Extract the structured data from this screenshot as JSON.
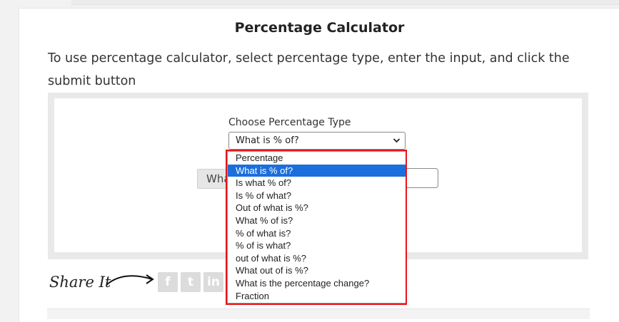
{
  "calculator": {
    "title": "Percentage Calculator",
    "instructions": "To use percentage calculator, select percentage type, enter the input, and click the submit button",
    "choose_label": "Choose Percentage Type",
    "selected_type": "What is % of?",
    "ghost_button_text": "Wha"
  },
  "dropdown": {
    "options": [
      "Percentage",
      "What is % of?",
      "Is what % of?",
      "Is % of what?",
      "Out of what is %?",
      "What % of is?",
      "% of what is?",
      "% of is what?",
      "out of what is %?",
      "What out of is %?",
      "What is the percentage change?",
      "Fraction"
    ],
    "selected_index": 1
  },
  "share": {
    "label": "Share It",
    "icons": [
      "facebook-icon",
      "twitter-icon",
      "linkedin-icon"
    ],
    "glyphs": [
      "f",
      "t",
      "in"
    ]
  },
  "colors": {
    "highlight_border": "#e8141a",
    "selected_option": "#1b6fdb",
    "panel_bg": "#e9e9e9"
  }
}
